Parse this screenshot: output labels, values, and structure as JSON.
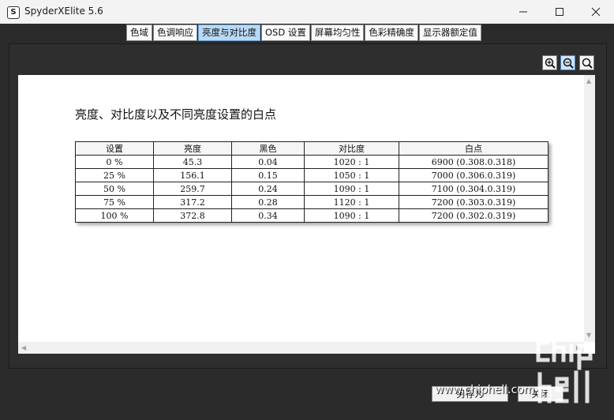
{
  "window": {
    "title": "SpyderXElite 5.6",
    "icon_letter": "S"
  },
  "tabs": [
    "色域",
    "色调响应",
    "亮度与对比度",
    "OSD 设置",
    "屏幕均匀性",
    "色彩精确度",
    "显示器额定值"
  ],
  "active_tab": 2,
  "report": {
    "title": "亮度、对比度以及不同亮度设置的白点",
    "columns": [
      "设置",
      "亮度",
      "黑色",
      "对比度",
      "白点"
    ],
    "rows": [
      [
        "0 %",
        "45.3",
        "0.04",
        "1020 : 1",
        "6900 (0.308.0.318)"
      ],
      [
        "25 %",
        "156.1",
        "0.15",
        "1050 : 1",
        "7000 (0.306.0.319)"
      ],
      [
        "50 %",
        "259.7",
        "0.24",
        "1090 : 1",
        "7100 (0.304.0.319)"
      ],
      [
        "75 %",
        "317.2",
        "0.28",
        "1120 : 1",
        "7200 (0.303.0.319)"
      ],
      [
        "100 %",
        "372.8",
        "0.34",
        "1090 : 1",
        "7200 (0.302.0.319)"
      ]
    ]
  },
  "zoom_icons": [
    "zoom-in-icon",
    "zoom-out-icon",
    "zoom-fit-icon"
  ],
  "footer": {
    "left_button": "另存为",
    "right_button": "关闭"
  },
  "watermark": {
    "text": "www.chiphell.com",
    "logo": "chip hell"
  },
  "colors": {
    "active_tab": "#b9daf7",
    "background": "#2b2b2b",
    "titlebar": "#f3f3f3"
  }
}
